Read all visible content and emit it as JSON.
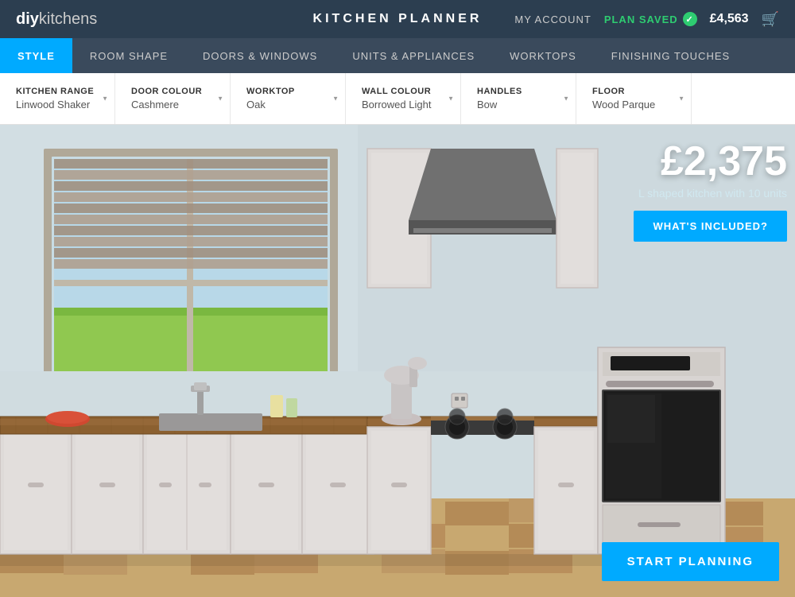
{
  "header": {
    "logo_diy": "diy",
    "logo_kitchens": "kitchens",
    "title": "KITCHEN PLANNER",
    "my_account": "MY ACCOUNT",
    "plan_saved": "PLAN SAVED",
    "price": "£4,563",
    "cart_icon": "🛒"
  },
  "nav": {
    "items": [
      {
        "id": "style",
        "label": "STYLE",
        "active": true
      },
      {
        "id": "room-shape",
        "label": "ROOM SHAPE",
        "active": false
      },
      {
        "id": "doors-windows",
        "label": "DOORS & WINDOWS",
        "active": false
      },
      {
        "id": "units-appliances",
        "label": "UNITS & APPLIANCES",
        "active": false
      },
      {
        "id": "worktops",
        "label": "WORKTOPS",
        "active": false
      },
      {
        "id": "finishing-touches",
        "label": "FINISHING TOUCHES",
        "active": false
      }
    ]
  },
  "options": [
    {
      "id": "kitchen-range",
      "label": "KITCHEN RANGE",
      "value": "Linwood Shaker"
    },
    {
      "id": "door-colour",
      "label": "DOOR COLOUR",
      "value": "Cashmere"
    },
    {
      "id": "worktop",
      "label": "WORKTOP",
      "value": "Oak"
    },
    {
      "id": "wall-colour",
      "label": "WALL COLOUR",
      "value": "Borrowed Light"
    },
    {
      "id": "handles",
      "label": "HANDLES",
      "value": "Bow"
    },
    {
      "id": "floor",
      "label": "FLOOR",
      "value": "Wood Parque"
    }
  ],
  "main": {
    "price": "£2,375",
    "description": "L shaped kitchen with 10 units",
    "whats_included_btn": "WHAT'S INCLUDED?",
    "start_planning_btn": "START PLANNING"
  }
}
